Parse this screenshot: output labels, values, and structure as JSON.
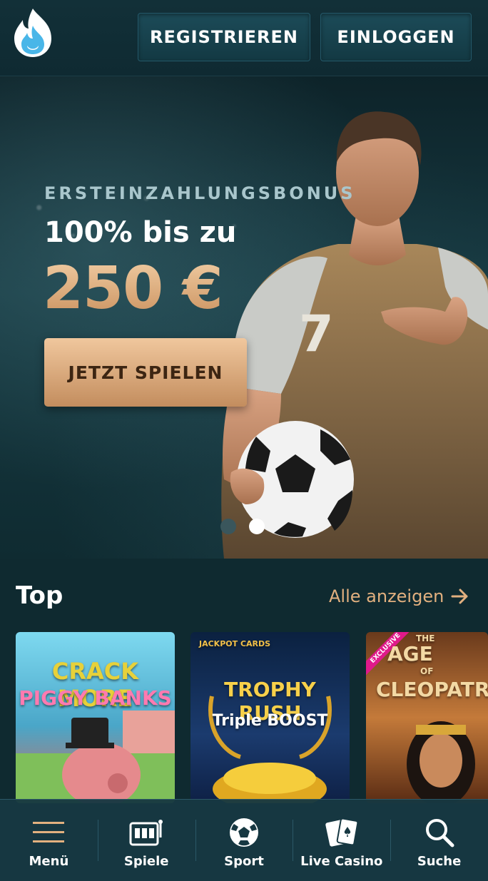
{
  "header": {
    "register_label": "REGISTRIEREN",
    "login_label": "EINLOGGEN"
  },
  "hero": {
    "subtitle": "ERSTEINZAHLUNGSBONUS",
    "line": "100% bis zu",
    "amount": "250 €",
    "cta_label": "JETZT SPIELEN",
    "player_number": "7",
    "slides_total": 2,
    "slide_active": 2
  },
  "section": {
    "title": "Top",
    "see_all": "Alle anzeigen"
  },
  "games": [
    {
      "title_line1": "CRACK MORE",
      "title_line2": "PIGGY BANKS"
    },
    {
      "provider": "JACKPOT CARDS",
      "title_line1": "TROPHY RUSH",
      "title_line2": "Triple BOOST"
    },
    {
      "badge": "EXCLUSIVE",
      "title_line0": "THE",
      "title_line1": "AGE",
      "title_of": "OF",
      "title_line2": "CLEOPATR"
    }
  ],
  "nav": {
    "menu": "Menü",
    "games": "Spiele",
    "sport": "Sport",
    "live_casino": "Live Casino",
    "search": "Suche"
  },
  "colors": {
    "accent": "#e2b07f",
    "background": "#0f2a30",
    "button": "#1c4b58"
  }
}
